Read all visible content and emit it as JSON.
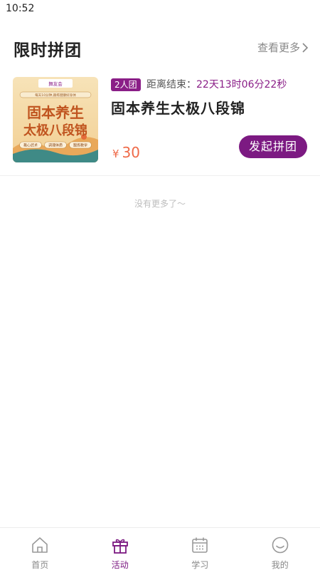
{
  "status_bar": {
    "time": "10:52"
  },
  "section": {
    "title": "限时拼团",
    "more_label": "查看更多"
  },
  "group_buy_item": {
    "badge": "2人团",
    "countdown": {
      "prefix": "距离结束：",
      "days": "22",
      "days_unit": "天",
      "hours": "13",
      "hours_unit": "时",
      "minutes": "06",
      "minutes_unit": "分",
      "seconds": "22",
      "seconds_unit": "秒"
    },
    "title": "固本养生太极八段锦",
    "price_symbol": "¥",
    "price": "30",
    "button_label": "发起拼团",
    "image": {
      "logo_text": "舞友会",
      "subtitle": "每天10分钟,跟练健康好身体",
      "title_line1": "固本养生",
      "title_line2": "太极八段锦",
      "tags": [
        "舞心武术",
        "调理体质",
        "跟练教学"
      ]
    }
  },
  "list_end_text": "没有更多了～",
  "tabbar": {
    "items": [
      {
        "label": "首页",
        "icon": "home-icon"
      },
      {
        "label": "活动",
        "icon": "gift-icon"
      },
      {
        "label": "学习",
        "icon": "calendar-icon"
      },
      {
        "label": "我的",
        "icon": "smile-icon"
      }
    ],
    "active_index": 1
  },
  "colors": {
    "accent": "#7c1a82",
    "price": "#ef6a48"
  }
}
